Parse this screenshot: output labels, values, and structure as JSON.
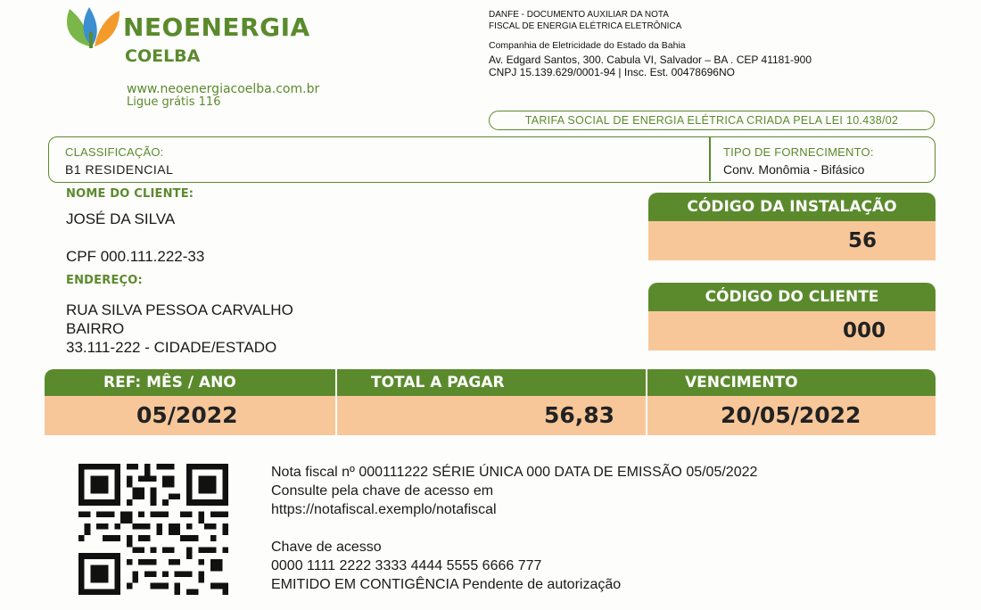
{
  "brand": {
    "name": "NEOENERGIA",
    "sub": "COELBA",
    "website": "www.neoenergiacoelba.com.br",
    "phone": "Ligue grátis 116"
  },
  "company": {
    "danfe_line1": "DANFE - DOCUMENTO AUXILIAR DA NOTA",
    "danfe_line2": "FISCAL DE ENERGIA ELÉTRICA ELETRÔNICA",
    "name": "Companhia de Eletricidade do Estado da Bahia",
    "address": "Av. Edgard Santos, 300. Cabula VI, Salvador – BA . CEP 41181-900",
    "cnpj": "CNPJ 15.139.629/0001-94 | Insc. Est. 00478696NO"
  },
  "tarifa": "TARIFA SOCIAL DE ENERGIA ELÉTRICA CRIADA PELA LEI 10.438/02",
  "classificacao": {
    "label": "CLASSIFICAÇÃO:",
    "value": "B1 RESIDENCIAL"
  },
  "fornecimento": {
    "label": "TIPO DE FORNECIMENTO:",
    "value": "Conv. Monômia - Bifásico"
  },
  "cliente": {
    "label": "NOME DO CLIENTE:",
    "name": "JOSÉ DA SILVA",
    "cpf": "CPF 000.111.222-33"
  },
  "endereco": {
    "label": "ENDEREÇO:",
    "line1": "RUA SILVA PESSOA CARVALHO",
    "line2": "BAIRRO",
    "line3": "33.111-222 - CIDADE/ESTADO"
  },
  "instalacao": {
    "label": "CÓDIGO DA INSTALAÇÃO",
    "value": "56"
  },
  "codigo_cliente": {
    "label": "CÓDIGO DO CLIENTE",
    "value": "000"
  },
  "summary": {
    "ref_label": "REF: MÊS / ANO",
    "ref_value": "05/2022",
    "total_label": "TOTAL A PAGAR",
    "total_value": "56,83",
    "venc_label": "VENCIMENTO",
    "venc_value": "20/05/2022"
  },
  "nota": {
    "line1": "Nota fiscal nº 000111222 SÉRIE ÚNICA 000 DATA DE EMISSÃO 05/05/2022",
    "line2": "Consulte pela chave de acesso em",
    "line3": "https://notafiscal.exemplo/notafiscal",
    "chave_label": "Chave de acesso",
    "chave_value": "0000 1111 2222 3333 4444 5555 6666 777",
    "status": "EMITIDO EM CONTIGÊNCIA Pendente de autorização"
  },
  "colors": {
    "brand_green": "#5b8a2d",
    "peach": "#f7c79a"
  }
}
